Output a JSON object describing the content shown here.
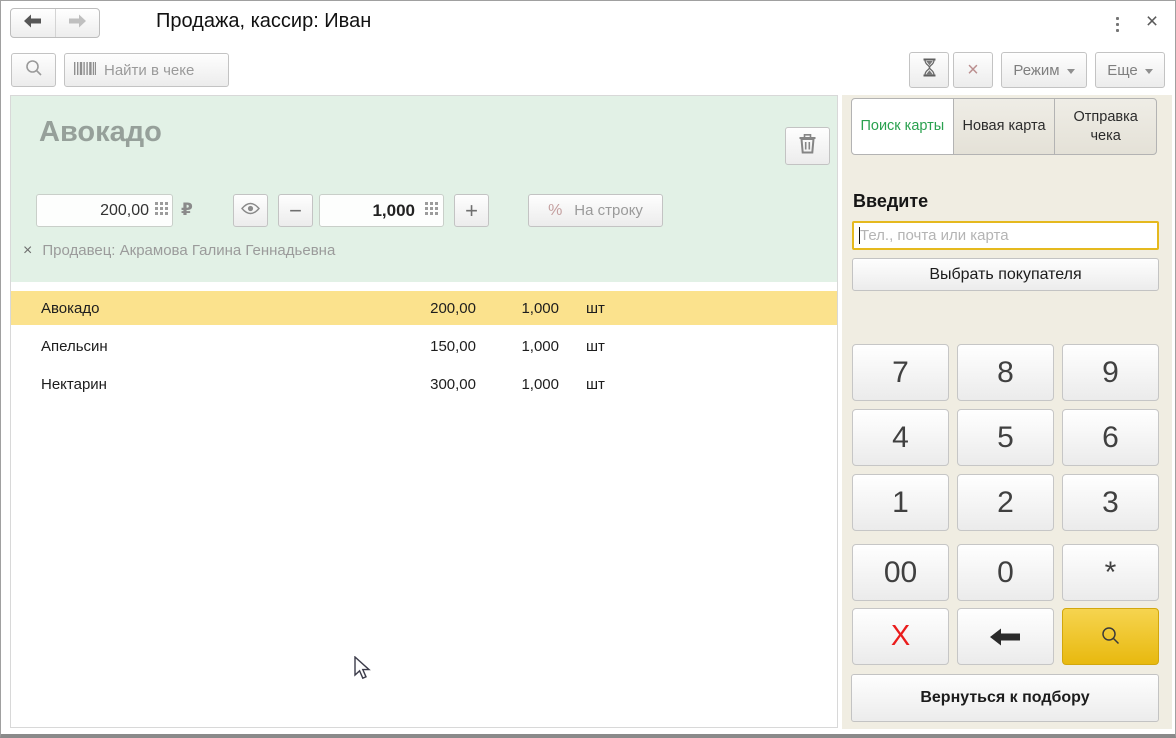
{
  "window": {
    "title": "Продажа, кассир: Иван"
  },
  "toolbar": {
    "find_placeholder": "Найти в чеке",
    "mode_button": "Режим",
    "more_button": "Еще"
  },
  "item_panel": {
    "title": "Авокадо",
    "price": "200,00",
    "currency": "₽",
    "minus": "−",
    "plus": "+",
    "quantity": "1,000",
    "discount_percent": "%",
    "discount_label": "На строку",
    "seller_remove": "×",
    "seller": "Продавец: Акрамова Галина Геннадьевна"
  },
  "receipt": {
    "rows": [
      {
        "name": "Авокадо",
        "price": "200,00",
        "qty": "1,000",
        "unit": "шт",
        "selected": true
      },
      {
        "name": "Апельсин",
        "price": "150,00",
        "qty": "1,000",
        "unit": "шт",
        "selected": false
      },
      {
        "name": "Нектарин",
        "price": "300,00",
        "qty": "1,000",
        "unit": "шт",
        "selected": false
      }
    ]
  },
  "customer_panel": {
    "tabs": [
      {
        "id": "card-search",
        "label": "Поиск карты",
        "active": true
      },
      {
        "id": "new-card",
        "label": "Новая карта",
        "active": false
      },
      {
        "id": "send-receipt",
        "label": "Отправка чека",
        "active": false
      }
    ],
    "heading": "Введите",
    "input_placeholder": "Тел., почта или карта",
    "select_customer": "Выбрать покупателя",
    "keypad_rows": [
      [
        "7",
        "8",
        "9"
      ],
      [
        "4",
        "5",
        "6"
      ],
      [
        "1",
        "2",
        "3"
      ],
      [
        "00",
        "0",
        "*"
      ]
    ],
    "clear_key": "X",
    "return_button": "Вернуться к подбору"
  },
  "colors": {
    "selected_row": "#fbe28d",
    "panel_green": "#e2f1e6",
    "panel_beige": "#f0ede2",
    "active_tab_text": "#2aa14f",
    "input_focus_border": "#e5b91e",
    "keypad_gold": "#e8b90f",
    "clear_key_red": "#ea1c1c"
  }
}
